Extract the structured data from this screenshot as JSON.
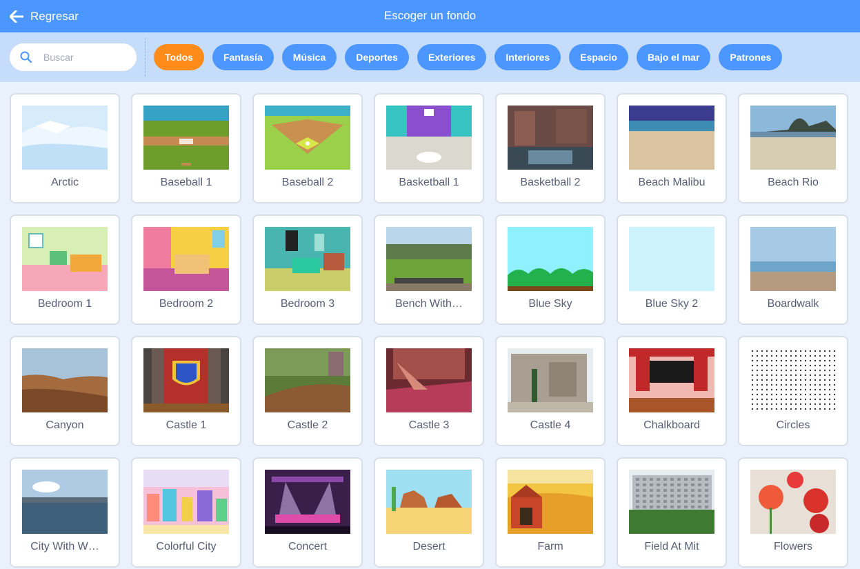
{
  "header": {
    "back_label": "Regresar",
    "title": "Escoger un fondo"
  },
  "search": {
    "placeholder": "Buscar",
    "value": ""
  },
  "tags": [
    {
      "label": "Todos",
      "active": true
    },
    {
      "label": "Fantasía",
      "active": false
    },
    {
      "label": "Música",
      "active": false
    },
    {
      "label": "Deportes",
      "active": false
    },
    {
      "label": "Exteriores",
      "active": false
    },
    {
      "label": "Interiores",
      "active": false
    },
    {
      "label": "Espacio",
      "active": false
    },
    {
      "label": "Bajo el mar",
      "active": false
    },
    {
      "label": "Patrones",
      "active": false
    }
  ],
  "colors": {
    "header": "#4c97ff",
    "toolbar": "#c6dcfb",
    "active_tag": "#ff8c1a",
    "tag": "#4c97ff",
    "background": "#e9f1fc"
  },
  "backdrops": [
    {
      "name": "Arctic",
      "icon": "arctic-thumbnail"
    },
    {
      "name": "Baseball 1",
      "icon": "baseball-1-thumbnail"
    },
    {
      "name": "Baseball 2",
      "icon": "baseball-2-thumbnail"
    },
    {
      "name": "Basketball 1",
      "icon": "basketball-1-thumbnail"
    },
    {
      "name": "Basketball 2",
      "icon": "basketball-2-thumbnail"
    },
    {
      "name": "Beach Malibu",
      "icon": "beach-malibu-thumbnail"
    },
    {
      "name": "Beach Rio",
      "icon": "beach-rio-thumbnail"
    },
    {
      "name": "Bedroom 1",
      "icon": "bedroom-1-thumbnail"
    },
    {
      "name": "Bedroom 2",
      "icon": "bedroom-2-thumbnail"
    },
    {
      "name": "Bedroom 3",
      "icon": "bedroom-3-thumbnail"
    },
    {
      "name": "Bench With…",
      "icon": "bench-with-view-thumbnail"
    },
    {
      "name": "Blue Sky",
      "icon": "blue-sky-thumbnail"
    },
    {
      "name": "Blue Sky 2",
      "icon": "blue-sky-2-thumbnail"
    },
    {
      "name": "Boardwalk",
      "icon": "boardwalk-thumbnail"
    },
    {
      "name": "Canyon",
      "icon": "canyon-thumbnail"
    },
    {
      "name": "Castle 1",
      "icon": "castle-1-thumbnail"
    },
    {
      "name": "Castle 2",
      "icon": "castle-2-thumbnail"
    },
    {
      "name": "Castle 3",
      "icon": "castle-3-thumbnail"
    },
    {
      "name": "Castle 4",
      "icon": "castle-4-thumbnail"
    },
    {
      "name": "Chalkboard",
      "icon": "chalkboard-thumbnail"
    },
    {
      "name": "Circles",
      "icon": "circles-thumbnail"
    },
    {
      "name": "City With W…",
      "icon": "city-with-water-thumbnail"
    },
    {
      "name": "Colorful City",
      "icon": "colorful-city-thumbnail"
    },
    {
      "name": "Concert",
      "icon": "concert-thumbnail"
    },
    {
      "name": "Desert",
      "icon": "desert-thumbnail"
    },
    {
      "name": "Farm",
      "icon": "farm-thumbnail"
    },
    {
      "name": "Field At Mit",
      "icon": "field-at-mit-thumbnail"
    },
    {
      "name": "Flowers",
      "icon": "flowers-thumbnail"
    }
  ]
}
